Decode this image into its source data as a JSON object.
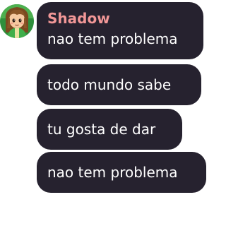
{
  "chat": {
    "author": "Shadow",
    "avatar_icon": "cartoon-girl-avatar-icon",
    "messages": [
      "nao tem problema",
      "todo mundo sabe",
      "tu gosta de dar",
      "nao tem problema"
    ]
  },
  "colors": {
    "bubble": "#26222f",
    "author_name": "#f19797",
    "text": "#ffffff"
  }
}
